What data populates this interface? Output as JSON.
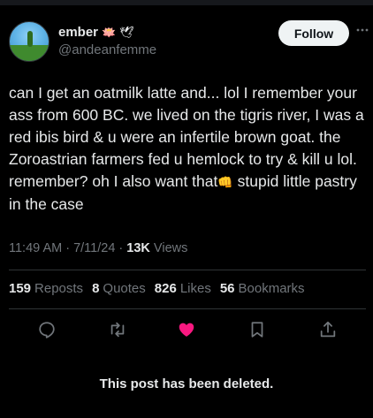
{
  "author": {
    "display_name": "ember",
    "emoji_1": "🪷",
    "emoji_2": "🕊",
    "handle": "@andeanfemme"
  },
  "follow_label": "Follow",
  "tweet": {
    "text": "can I get an oatmilk latte and... lol I remember your ass from 600 BC. we lived on the tigris river, I was a red ibis bird & u were an infertile brown goat. the Zoroastrian farmers fed u hemlock to try & kill u lol. remember? oh I also want that",
    "emoji_end": "👊",
    "text_end": " stupid little pastry in the case"
  },
  "meta": {
    "time": "11:49 AM",
    "sep1": " · ",
    "date": "7/11/24",
    "sep2": " · ",
    "views_count": "13K",
    "views_label": " Views"
  },
  "stats": [
    {
      "count": "159",
      "label": "Reposts"
    },
    {
      "count": "8",
      "label": "Quotes"
    },
    {
      "count": "826",
      "label": "Likes"
    },
    {
      "count": "56",
      "label": "Bookmarks"
    }
  ],
  "actions": {
    "reply_icon": "reply-icon",
    "repost_icon": "repost-icon",
    "like_icon": "heart-icon",
    "bookmark_icon": "bookmark-icon",
    "share_icon": "share-icon",
    "like_color": "#f91880",
    "icon_color": "#71767b"
  },
  "deleted_notice": "This post has been deleted."
}
